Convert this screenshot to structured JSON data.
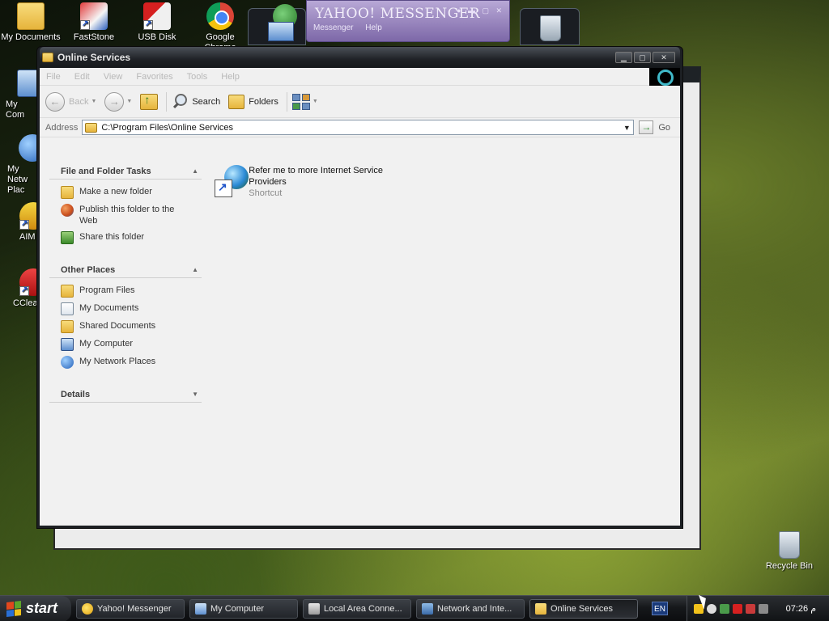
{
  "desktop": {
    "icons": [
      {
        "label": "My Documents",
        "icon": "my-documents-icon"
      },
      {
        "label": "FastStone",
        "icon": "faststone-icon"
      },
      {
        "label": "USB Disk",
        "icon": "usb-disk-icon"
      },
      {
        "label": "Google Chrome",
        "icon": "chrome-icon"
      },
      {
        "label": "My Com",
        "icon": "my-computer-icon"
      },
      {
        "label": "My Netw Plac",
        "icon": "network-places-icon"
      },
      {
        "label": "AIM",
        "icon": "aim-icon"
      },
      {
        "label": "CClea",
        "icon": "ccleaner-icon"
      },
      {
        "label": "Recycle Bin",
        "icon": "recycle-bin-icon"
      }
    ]
  },
  "yahoo": {
    "title": "YAHOO! MESSENGER",
    "menu": [
      "Messenger",
      "Help"
    ]
  },
  "window": {
    "title": "Online Services",
    "menu": [
      "File",
      "Edit",
      "View",
      "Favorites",
      "Tools",
      "Help"
    ],
    "toolbar": {
      "back_label": "Back",
      "search_label": "Search",
      "folders_label": "Folders"
    },
    "address": {
      "label": "Address",
      "value": "C:\\Program Files\\Online Services",
      "go_label": "Go"
    },
    "taskpane": {
      "file_folder_tasks": {
        "title": "File and Folder Tasks",
        "items": [
          "Make a new folder",
          "Publish this folder to the Web",
          "Share this folder"
        ]
      },
      "other_places": {
        "title": "Other Places",
        "items": [
          "Program Files",
          "My Documents",
          "Shared Documents",
          "My Computer",
          "My Network Places"
        ]
      },
      "details": {
        "title": "Details"
      }
    },
    "files": [
      {
        "name": "Refer me to more Internet Service Providers",
        "type": "Shortcut"
      }
    ]
  },
  "taskbar": {
    "start_label": "start",
    "tasks": [
      "Yahoo! Messenger",
      "My Computer",
      "Local Area Conne...",
      "Network and Inte...",
      "Online Services"
    ],
    "language": "EN",
    "clock": "07:26 م"
  }
}
